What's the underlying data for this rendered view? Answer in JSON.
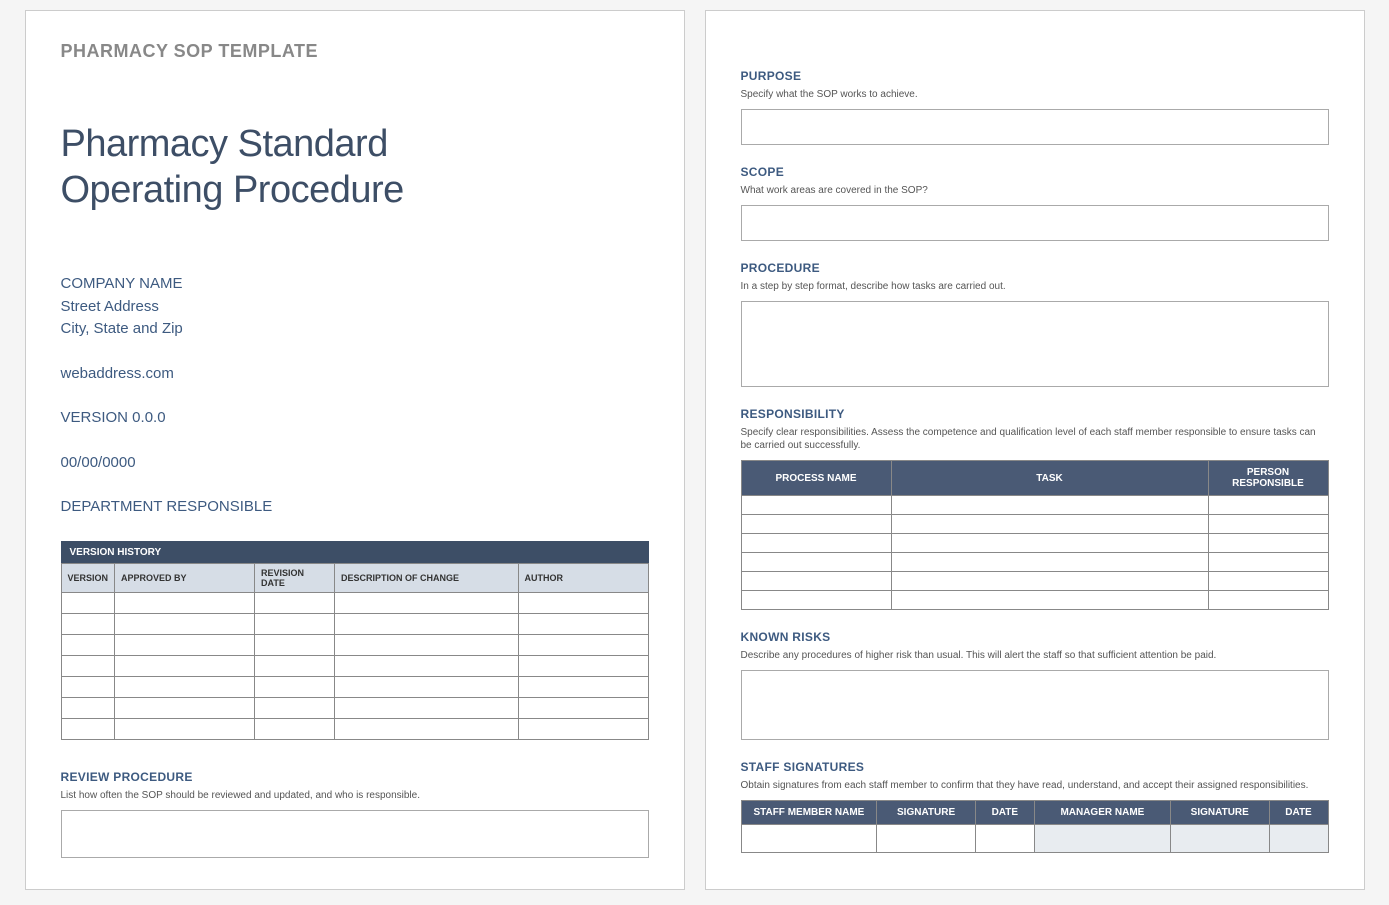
{
  "page1": {
    "header": "PHARMACY SOP TEMPLATE",
    "title_line1": "Pharmacy Standard",
    "title_line2": "Operating Procedure",
    "company": {
      "name": "COMPANY NAME",
      "street": "Street Address",
      "citystate": "City, State and Zip",
      "web": "webaddress.com",
      "version": "VERSION 0.0.0",
      "date": "00/00/0000",
      "dept": "DEPARTMENT RESPONSIBLE"
    },
    "version_history": {
      "caption": "VERSION HISTORY",
      "cols": {
        "version": "VERSION",
        "approved": "APPROVED BY",
        "revision": "REVISION DATE",
        "desc": "DESCRIPTION OF CHANGE",
        "author": "AUTHOR"
      }
    },
    "review": {
      "title": "REVIEW PROCEDURE",
      "desc": "List how often the SOP should be reviewed and updated, and who is responsible."
    }
  },
  "page2": {
    "purpose": {
      "title": "PURPOSE",
      "desc": "Specify what the SOP works to achieve."
    },
    "scope": {
      "title": "SCOPE",
      "desc": "What work areas are covered in the SOP?"
    },
    "procedure": {
      "title": "PROCEDURE",
      "desc": "In a step by step format, describe how tasks are carried out."
    },
    "responsibility": {
      "title": "RESPONSIBILITY",
      "desc": "Specify clear responsibilities.  Assess the competence and qualification level of each staff member responsible to ensure tasks can be carried out successfully.",
      "cols": {
        "process": "PROCESS NAME",
        "task": "TASK",
        "person": "PERSON RESPONSIBLE"
      }
    },
    "risks": {
      "title": "KNOWN RISKS",
      "desc": "Describe any procedures of higher risk than usual.  This will alert the staff so that sufficient attention be paid."
    },
    "signatures": {
      "title": "STAFF SIGNATURES",
      "desc": "Obtain signatures from each staff member to confirm that they have read, understand, and accept their assigned responsibilities.",
      "cols": {
        "staff": "STAFF MEMBER NAME",
        "sig": "SIGNATURE",
        "date": "DATE",
        "manager": "MANAGER NAME",
        "msig": "SIGNATURE",
        "mdate": "DATE"
      }
    }
  }
}
